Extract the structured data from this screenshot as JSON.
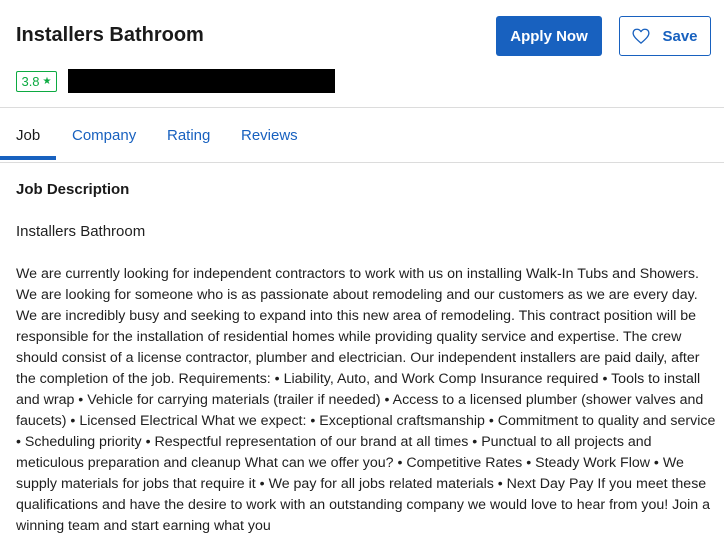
{
  "job": {
    "title": "Installers Bathroom",
    "rating": "3.8",
    "rating_icon": "star-icon"
  },
  "actions": {
    "apply_label": "Apply Now",
    "save_label": "Save",
    "save_icon": "heart-icon"
  },
  "tabs": [
    {
      "label": "Job",
      "active": true
    },
    {
      "label": "Company",
      "active": false
    },
    {
      "label": "Rating",
      "active": false
    },
    {
      "label": "Reviews",
      "active": false
    }
  ],
  "content": {
    "heading": "Job Description",
    "subtitle": "Installers Bathroom",
    "description": "We are currently looking for independent contractors to work with us on installing Walk-In Tubs and Showers. We are looking for someone who is as passionate about remodeling and our customers as we are every day. We are incredibly busy and seeking to expand into this new area of remodeling. This contract position will be responsible for the installation of residential homes while providing quality service and expertise. The crew should consist of a license contractor, plumber and electrician. Our independent installers are paid daily, after the completion of the job. Requirements: • Liability, Auto, and Work Comp Insurance required • Tools to install and wrap • Vehicle for carrying materials (trailer if needed) • Access to a licensed plumber (shower valves and faucets) • Licensed Electrical What we expect: • Exceptional craftsmanship • Commitment to quality and service • Scheduling priority • Respectful representation of our brand at all times • Punctual to all projects and meticulous preparation and cleanup What can we offer you? • Competitive Rates • Steady Work Flow • We supply materials for jobs that require it • We pay for all jobs related materials • Next Day Pay If you meet these qualifications and have the desire to work with an outstanding company we would love to hear from you! Join a winning team and start earning what you"
  },
  "colors": {
    "accent": "#1861bf",
    "rating_green": "#0caa41",
    "divider": "#dcdcdc"
  }
}
